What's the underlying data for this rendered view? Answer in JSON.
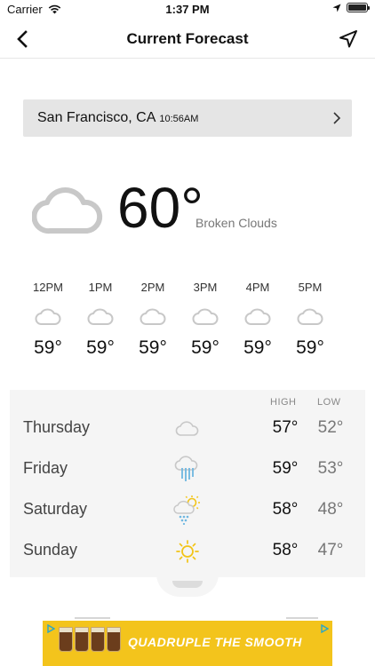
{
  "status_bar": {
    "carrier": "Carrier",
    "time": "1:37 PM"
  },
  "nav": {
    "title": "Current Forecast"
  },
  "location": {
    "city": "San Francisco, CA",
    "time": "10:56AM"
  },
  "current": {
    "temp": "60°",
    "description": "Broken Clouds",
    "icon": "cloud-icon"
  },
  "hourly": [
    {
      "time": "12PM",
      "temp": "59°",
      "icon": "cloud-icon"
    },
    {
      "time": "1PM",
      "temp": "59°",
      "icon": "cloud-icon"
    },
    {
      "time": "2PM",
      "temp": "59°",
      "icon": "cloud-icon"
    },
    {
      "time": "3PM",
      "temp": "59°",
      "icon": "cloud-icon"
    },
    {
      "time": "4PM",
      "temp": "59°",
      "icon": "cloud-icon"
    },
    {
      "time": "5PM",
      "temp": "59°",
      "icon": "cloud-icon"
    }
  ],
  "daily": {
    "high_label": "HIGH",
    "low_label": "LOW",
    "days": [
      {
        "name": "Thursday",
        "high": "57°",
        "low": "52°",
        "icon": "cloud-icon"
      },
      {
        "name": "Friday",
        "high": "59°",
        "low": "53°",
        "icon": "rain-cloud-icon"
      },
      {
        "name": "Saturday",
        "high": "58°",
        "low": "48°",
        "icon": "sun-rain-icon"
      },
      {
        "name": "Sunday",
        "high": "58°",
        "low": "47°",
        "icon": "sun-icon"
      }
    ]
  },
  "ad": {
    "text": "QUADRUPLE THE SMOOTH"
  },
  "colors": {
    "accent_rain": "#6fb7e0",
    "accent_sun": "#f2c418",
    "panel": "#f5f5f5",
    "ad_bg": "#f3c41c"
  }
}
